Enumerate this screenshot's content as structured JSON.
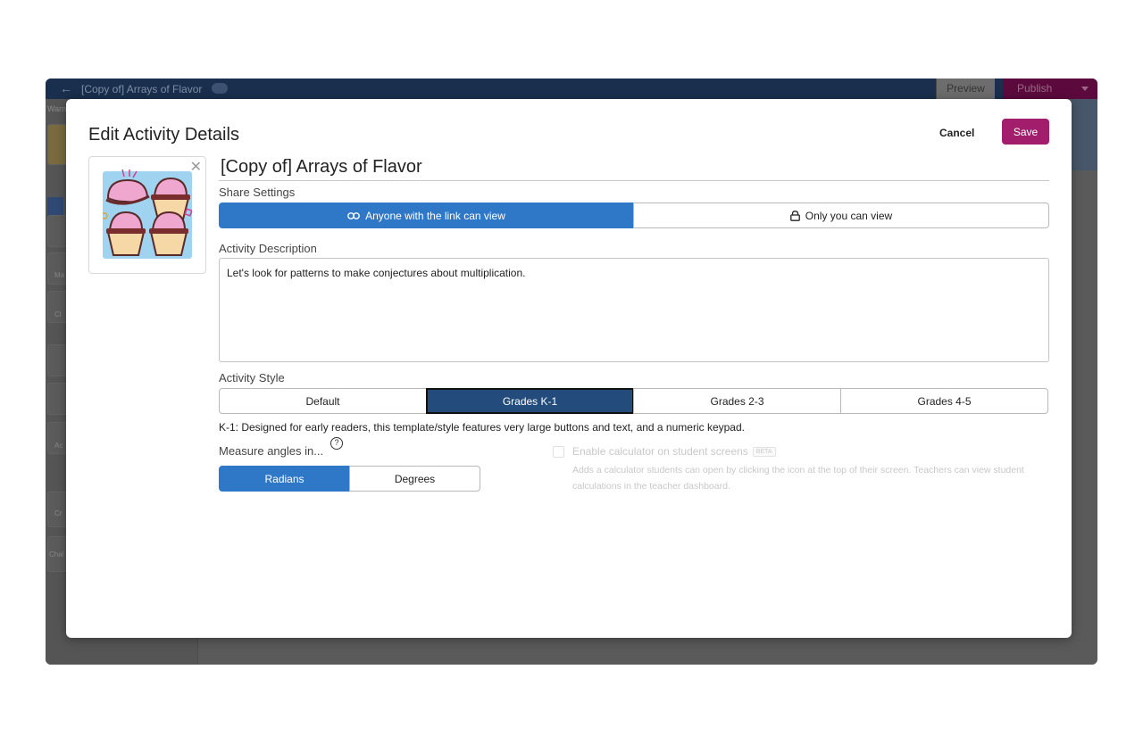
{
  "app": {
    "back_glyph": "←",
    "title": "[Copy of] Arrays of Flavor",
    "preview_label": "Preview",
    "publish_label": "Publish",
    "sidebar_warn": "Warn",
    "sidebar_labels": [
      "Ma",
      "Cl",
      "Ac",
      "Cr",
      "Chal"
    ]
  },
  "modal": {
    "title": "Edit Activity Details",
    "cancel_label": "Cancel",
    "save_label": "Save",
    "thumbnail_close": "✕",
    "activity_title": "[Copy of] Arrays of Flavor",
    "share": {
      "label": "Share Settings",
      "options": [
        "Anyone with the link can view",
        "Only you can view"
      ],
      "selected": 0
    },
    "description": {
      "label": "Activity Description",
      "value": "Let's look for patterns to make conjectures about multiplication."
    },
    "style": {
      "label": "Activity Style",
      "options": [
        "Default",
        "Grades K-1",
        "Grades 2-3",
        "Grades 4-5"
      ],
      "selected": 1,
      "note": "K-1: Designed for early readers, this template/style features very large buttons and text, and a numeric keypad."
    },
    "angles": {
      "label": "Measure angles in...",
      "help_glyph": "?",
      "options": [
        "Radians",
        "Degrees"
      ],
      "selected": 0
    },
    "calculator": {
      "label": "Enable calculator on student screens",
      "badge": "BETA",
      "description": "Adds a calculator students can open by clicking the icon at the top of their screen. Teachers can view student calculations in the teacher dashboard.",
      "checked": false
    }
  },
  "colors": {
    "primary_blue": "#2f78c8",
    "dark_blue": "#234b7c",
    "save_magenta": "#a21e6c"
  }
}
